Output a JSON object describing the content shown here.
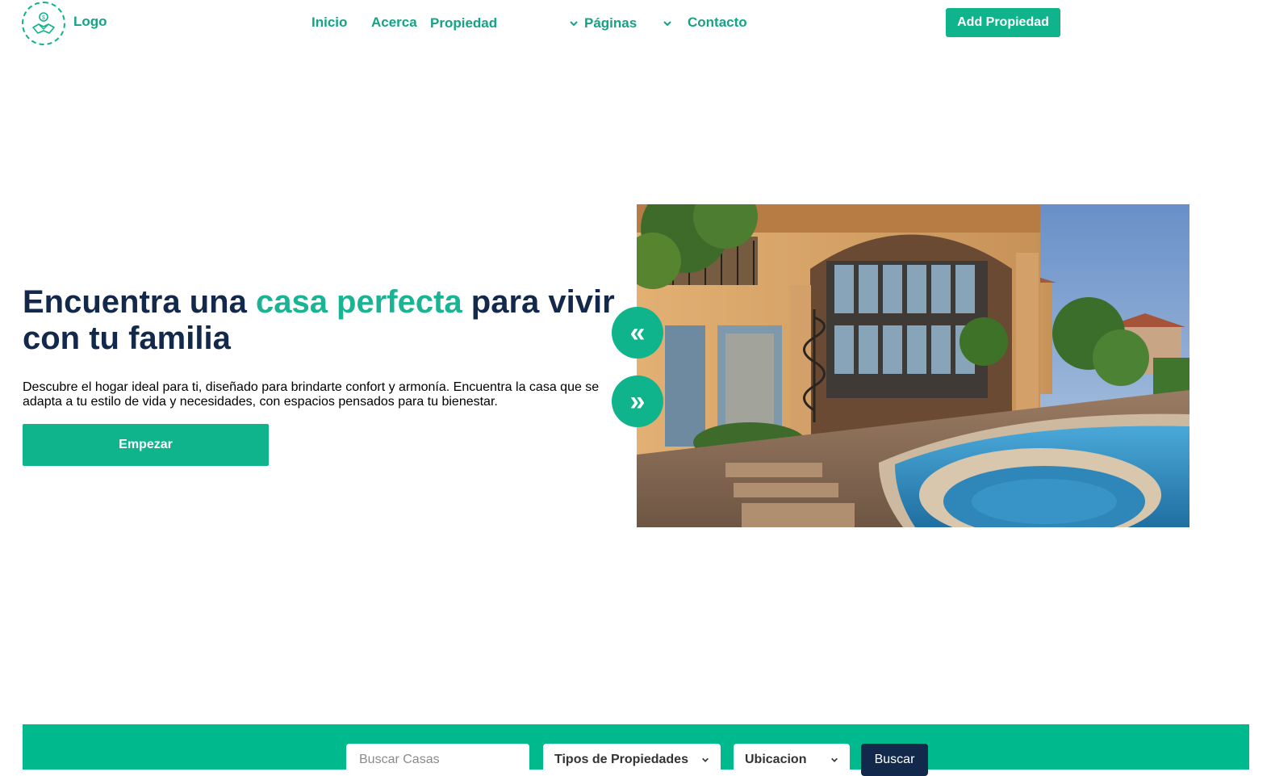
{
  "header": {
    "logo_text": "Logo",
    "nav": {
      "inicio": "Inicio",
      "acerca": "Acerca",
      "propiedad": "Propiedad",
      "paginas": "Páginas",
      "contacto": "Contacto"
    },
    "add_button": "Add Propiedad"
  },
  "hero": {
    "title_part1": "Encuentra una ",
    "title_accent": "casa perfecta",
    "title_part2": " para vivir con tu familia",
    "description": "Descubre el hogar ideal para ti, diseñado para brindarte confort y armonía. Encuentra la casa que se adapta a tu estilo de vida y necesidades, con espacios pensados para tu bienestar.",
    "cta_label": "Empezar",
    "prev_arrow": "«",
    "next_arrow": "»"
  },
  "search": {
    "input_placeholder": "Buscar Casas",
    "type_select": "Tipos de Propiedades",
    "location_select": "Ubicacion",
    "button_label": "Buscar"
  },
  "colors": {
    "accent": "#0fb38c",
    "navy": "#13294b"
  }
}
